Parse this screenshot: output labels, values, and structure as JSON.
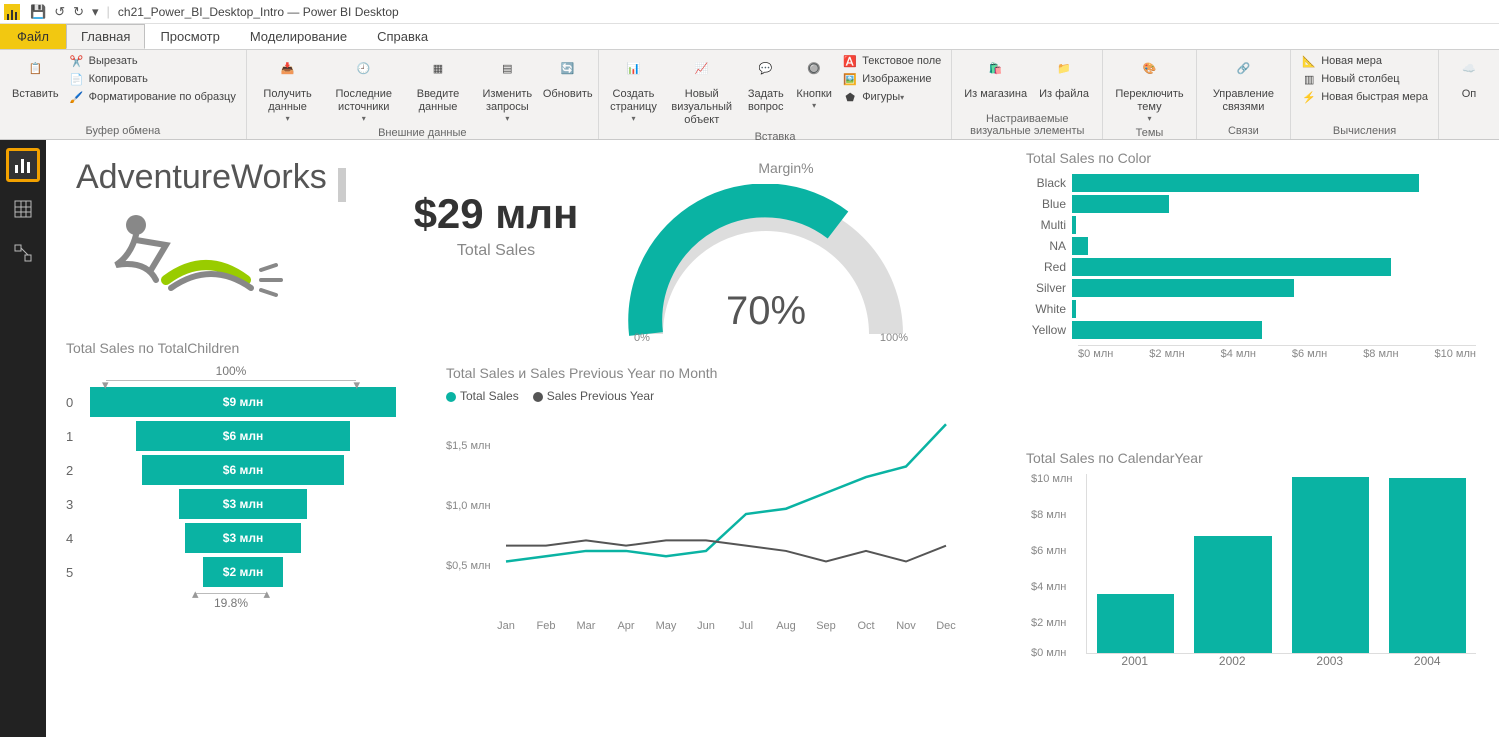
{
  "app": {
    "title": "ch21_Power_BI_Desktop_Intro — Power BI Desktop"
  },
  "menu": {
    "file": "Файл",
    "home": "Главная",
    "view": "Просмотр",
    "modeling": "Моделирование",
    "help": "Справка"
  },
  "ribbon": {
    "paste": "Вставить",
    "cut": "Вырезать",
    "copy": "Копировать",
    "format_painter": "Форматирование по образцу",
    "clipboard_group": "Буфер обмена",
    "get_data": "Получить данные",
    "recent_sources": "Последние источники",
    "enter_data": "Введите данные",
    "edit_queries": "Изменить запросы",
    "refresh": "Обновить",
    "external_data_group": "Внешние данные",
    "new_page": "Создать страницу",
    "new_visual": "Новый визуальный объект",
    "ask_question": "Задать вопрос",
    "buttons": "Кнопки",
    "text_box": "Текстовое поле",
    "image": "Изображение",
    "shapes": "Фигуры",
    "insert_group": "Вставка",
    "from_marketplace": "Из магазина",
    "from_file": "Из файла",
    "custom_visuals_group": "Настраиваемые визуальные элементы",
    "switch_theme": "Переключить тему",
    "themes_group": "Темы",
    "manage_relationships": "Управление связями",
    "relationships_group": "Связи",
    "new_measure": "Новая мера",
    "new_column": "Новый столбец",
    "new_quick_measure": "Новая быстрая мера",
    "calculations_group": "Вычисления",
    "publish": "Оп"
  },
  "report": {
    "title": "AdventureWorks",
    "kpi_value": "$29 млн",
    "kpi_label": "Total Sales"
  },
  "gauge": {
    "title": "Margin%",
    "value": "70%",
    "min": "0%",
    "max": "100%"
  },
  "funnel": {
    "title": "Total Sales по TotalChildren",
    "top_label": "100%",
    "bottom_label": "19.8%",
    "items": [
      {
        "cat": "0",
        "label": "$9 млн"
      },
      {
        "cat": "1",
        "label": "$6 млн"
      },
      {
        "cat": "2",
        "label": "$6 млн"
      },
      {
        "cat": "3",
        "label": "$3 млн"
      },
      {
        "cat": "4",
        "label": "$3 млн"
      },
      {
        "cat": "5",
        "label": "$2 млн"
      }
    ]
  },
  "line": {
    "title": "Total Sales и Sales Previous Year по Month",
    "legend1": "Total Sales",
    "legend2": "Sales Previous Year",
    "yticks": [
      "$1,5 млн",
      "$1,0 млн",
      "$0,5 млн"
    ],
    "xticks": [
      "Jan",
      "Feb",
      "Mar",
      "Apr",
      "May",
      "Jun",
      "Jul",
      "Aug",
      "Sep",
      "Oct",
      "Nov",
      "Dec"
    ]
  },
  "hbar": {
    "title": "Total Sales по Color",
    "cats": [
      "Black",
      "Blue",
      "Multi",
      "NA",
      "Red",
      "Silver",
      "White",
      "Yellow"
    ],
    "xticks": [
      "$0 млн",
      "$2 млн",
      "$4 млн",
      "$6 млн",
      "$8 млн",
      "$10 млн"
    ]
  },
  "col": {
    "title": "Total Sales по CalendarYear",
    "yticks": [
      "$10 млн",
      "$8 млн",
      "$6 млн",
      "$4 млн",
      "$2 млн",
      "$0 млн"
    ],
    "xticks": [
      "2001",
      "2002",
      "2003",
      "2004"
    ]
  },
  "chart_data": [
    {
      "type": "gauge",
      "title": "Margin%",
      "value": 70,
      "min": 0,
      "max": 100
    },
    {
      "type": "funnel",
      "title": "Total Sales по TotalChildren",
      "categories": [
        "0",
        "1",
        "2",
        "3",
        "4",
        "5"
      ],
      "values": [
        9,
        6,
        6,
        3,
        3,
        2
      ],
      "unit": "млн $",
      "top_pct": 100,
      "bottom_pct": 19.8
    },
    {
      "type": "line",
      "title": "Total Sales и Sales Previous Year по Month",
      "x": [
        "Jan",
        "Feb",
        "Mar",
        "Apr",
        "May",
        "Jun",
        "Jul",
        "Aug",
        "Sep",
        "Oct",
        "Nov",
        "Dec"
      ],
      "series": [
        {
          "name": "Total Sales",
          "values": [
            0.45,
            0.5,
            0.55,
            0.55,
            0.5,
            0.55,
            0.9,
            0.95,
            1.1,
            1.25,
            1.35,
            1.75
          ]
        },
        {
          "name": "Sales Previous Year",
          "values": [
            0.6,
            0.6,
            0.65,
            0.6,
            0.65,
            0.65,
            0.6,
            0.55,
            0.45,
            0.55,
            0.45,
            0.6
          ]
        }
      ],
      "ylabel": "млн $",
      "ylim": [
        0,
        1.75
      ]
    },
    {
      "type": "bar",
      "orientation": "horizontal",
      "title": "Total Sales по Color",
      "categories": [
        "Black",
        "Blue",
        "Multi",
        "NA",
        "Red",
        "Silver",
        "White",
        "Yellow"
      ],
      "values": [
        8.6,
        2.4,
        0.1,
        0.4,
        7.9,
        5.5,
        0.1,
        4.7
      ],
      "xlabel": "млн $",
      "xlim": [
        0,
        10
      ]
    },
    {
      "type": "bar",
      "title": "Total Sales по CalendarYear",
      "categories": [
        "2001",
        "2002",
        "2003",
        "2004"
      ],
      "values": [
        3.3,
        6.5,
        9.8,
        9.7
      ],
      "ylabel": "млн $",
      "ylim": [
        0,
        10
      ]
    }
  ]
}
